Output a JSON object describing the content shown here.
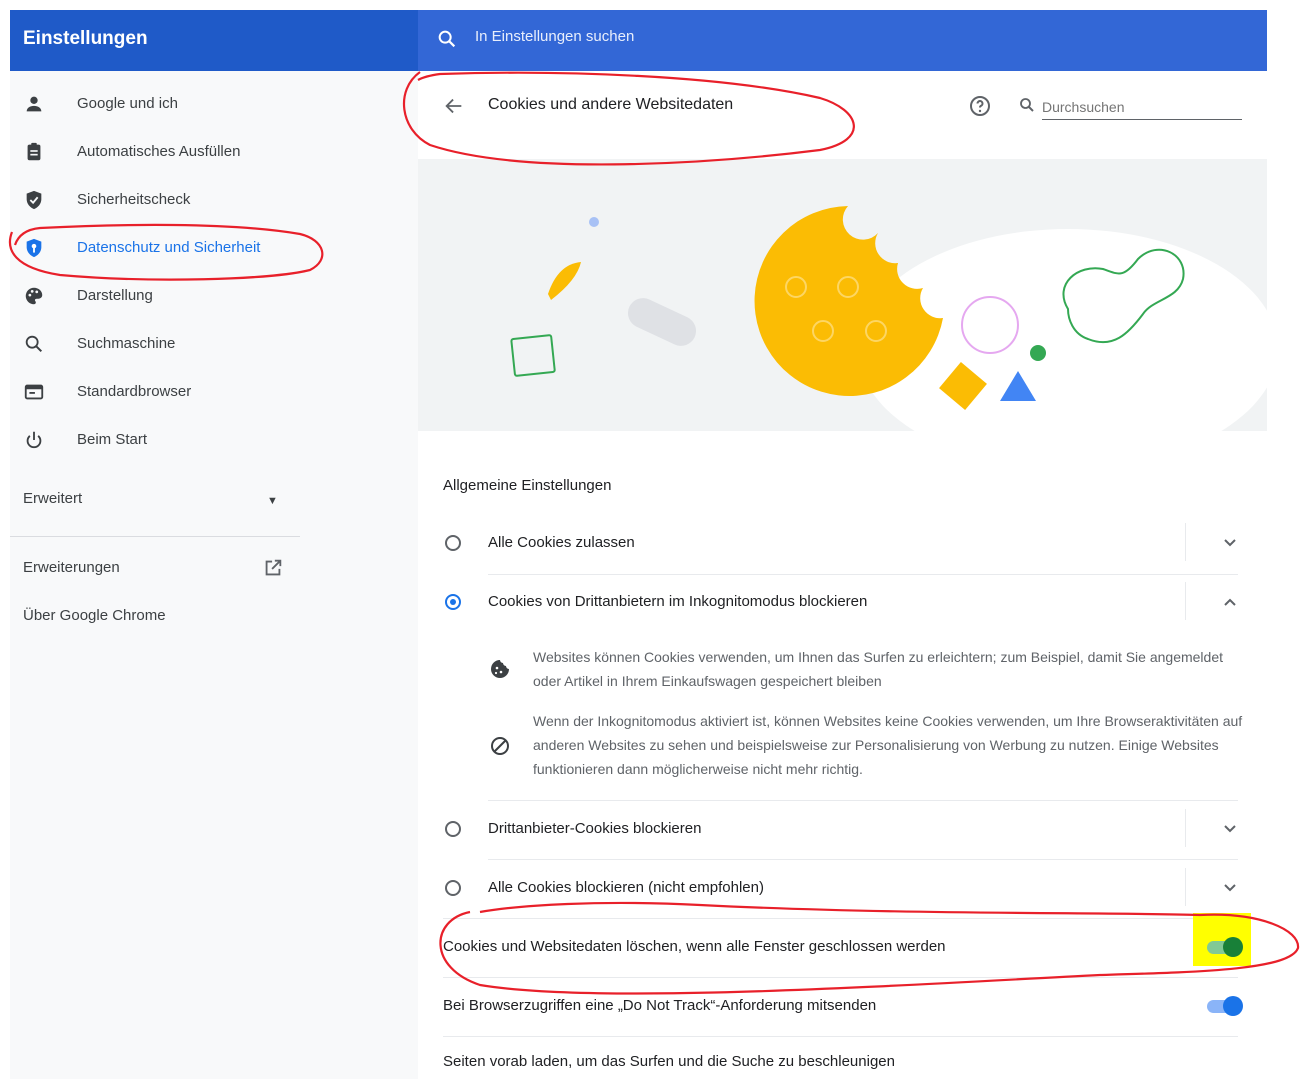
{
  "header": {
    "app_title": "Einstellungen",
    "search_placeholder": "In Einstellungen suchen"
  },
  "sidebar": {
    "items": [
      {
        "label": "Google und ich",
        "icon": "person-icon"
      },
      {
        "label": "Automatisches Ausfüllen",
        "icon": "clipboard-icon"
      },
      {
        "label": "Sicherheitscheck",
        "icon": "shield-check-icon"
      },
      {
        "label": "Datenschutz und Sicherheit",
        "icon": "privacy-shield-icon",
        "active": true
      },
      {
        "label": "Darstellung",
        "icon": "palette-icon"
      },
      {
        "label": "Suchmaschine",
        "icon": "search-icon"
      },
      {
        "label": "Standardbrowser",
        "icon": "browser-window-icon"
      },
      {
        "label": "Beim Start",
        "icon": "power-icon"
      }
    ],
    "advanced_label": "Erweitert",
    "extensions_label": "Erweiterungen",
    "about_label": "Über Google Chrome"
  },
  "page": {
    "title": "Cookies und andere Websitedaten",
    "search_placeholder": "Durchsuchen",
    "section_title": "Allgemeine Einstellungen",
    "options": [
      {
        "label": "Alle Cookies zulassen",
        "selected": false
      },
      {
        "label": "Cookies von Drittanbietern im Inkognitomodus blockieren",
        "selected": true
      },
      {
        "label": "Drittanbieter-Cookies blockieren",
        "selected": false
      },
      {
        "label": "Alle Cookies blockieren (nicht empfohlen)",
        "selected": false
      }
    ],
    "details": [
      {
        "icon": "cookie-icon",
        "text": "Websites können Cookies verwenden, um Ihnen das Surfen zu erleichtern; zum Beispiel, damit Sie angemeldet oder Artikel in Ihrem Einkaufswagen gespeichert bleiben"
      },
      {
        "icon": "blocked-icon",
        "text": "Wenn der Inkognitomodus aktiviert ist, können Websites keine Cookies verwenden, um Ihre Browseraktivitäten auf anderen Websites zu sehen und beispielsweise zur Personalisierung von Werbung zu nutzen. Einige Websites funktionieren dann möglicherweise nicht mehr richtig."
      }
    ],
    "toggles": [
      {
        "label": "Cookies und Websitedaten löschen, wenn alle Fenster geschlossen werden",
        "on": true,
        "color": "#188038"
      },
      {
        "label": "Bei Browserzugriffen eine „Do Not Track“-Anforderung mitsenden",
        "on": true,
        "color": "#1a73e8"
      }
    ],
    "bottom_label": "Seiten vorab laden, um das Surfen und die Suche zu beschleunigen"
  },
  "colors": {
    "accent": "#1a73e8",
    "header": "#3367d6",
    "annotation": "#e8202a",
    "highlight": "#ffff00"
  }
}
